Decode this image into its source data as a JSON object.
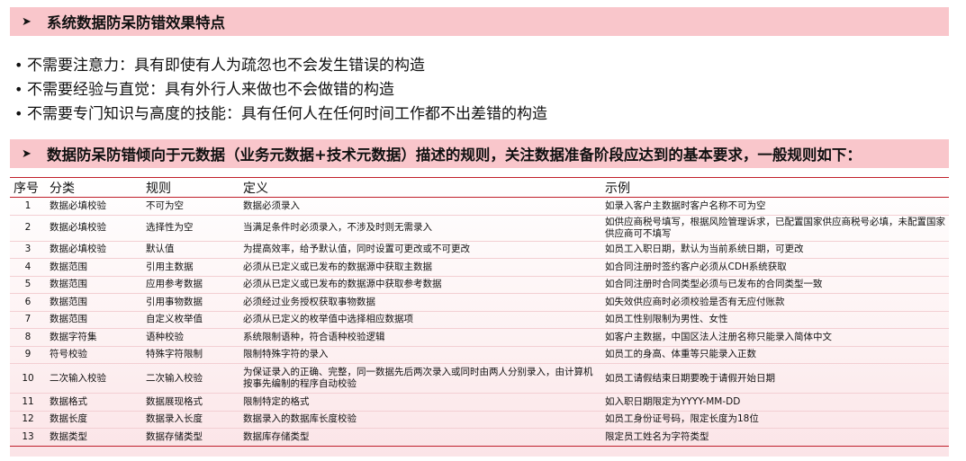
{
  "banner1": {
    "arrow": "➤",
    "text": "系统数据防呆防错效果特点"
  },
  "bullets": [
    {
      "dot": "•",
      "text": "不需要注意力：具有即使有人为疏忽也不会发生错误的构造"
    },
    {
      "dot": "•",
      "text": "不需要经验与直觉：具有外行人来做也不会做错的构造"
    },
    {
      "dot": "•",
      "text": "不需要专门知识与高度的技能：具有任何人在任何时间工作都不出差错的构造"
    }
  ],
  "banner2": {
    "arrow": "➤",
    "text": "数据防呆防错倾向于元数据（业务元数据+技术元数据）描述的规则，关注数据准备阶段应达到的基本要求，一般规则如下："
  },
  "table": {
    "headers": [
      "序号",
      "分类",
      "规则",
      "定义",
      "示例"
    ],
    "rows": [
      [
        "1",
        "数据必填校验",
        "不可为空",
        "数据必须录入",
        "如录入客户主数据时客户名称不可为空"
      ],
      [
        "2",
        "数据必填校验",
        "选择性为空",
        "当满足条件时必须录入，不涉及时则无需录入",
        "如供应商税号填写，根据风险管理诉求，已配置国家供应商税号必填，未配置国家供应商可不填写"
      ],
      [
        "3",
        "数据必填校验",
        "默认值",
        "为提高效率，给予默认值，同时设置可更改或不可更改",
        "如员工入职日期，默认为当前系统日期，可更改"
      ],
      [
        "4",
        "数据范围",
        "引用主数据",
        "必须从已定义或已发布的数据源中获取主数据",
        "如合同注册时签约客户必须从CDH系统获取"
      ],
      [
        "5",
        "数据范围",
        "应用参考数据",
        "必须从已定义或已发布的数据源中获取参考数据",
        "如合同注册时合同类型必须与已发布的合同类型一致"
      ],
      [
        "6",
        "数据范围",
        "引用事物数据",
        "必须经过业务授权获取事物数据",
        "如失效供应商时必须校验是否有无应付账款"
      ],
      [
        "7",
        "数据范围",
        "自定义枚举值",
        "必须从已定义的枚举值中选择相应数据项",
        "如员工性别限制为男性、女性"
      ],
      [
        "8",
        "数据字符集",
        "语种校验",
        "系统限制语种，符合语种校验逻辑",
        "如客户主数据，中国区法人注册名称只能录入简体中文"
      ],
      [
        "9",
        "符号校验",
        "特殊字符限制",
        "限制特殊字符的录入",
        "如员工的身高、体重等只能录入正数"
      ],
      [
        "10",
        "二次输入校验",
        "二次输入校验",
        "为保证录入的正确、完整，同一数据先后两次录入或同时由两人分别录入，由计算机按事先编制的程序自动校验",
        "如员工请假结束日期要晚于请假开始日期"
      ],
      [
        "11",
        "数据格式",
        "数据展现格式",
        "限制特定的格式",
        "如入职日期限定为YYYY-MM-DD"
      ],
      [
        "12",
        "数据长度",
        "数据录入长度",
        "数据录入的数据库长度校验",
        "如员工身份证号码，限定长度为18位"
      ],
      [
        "13",
        "数据类型",
        "数据存储类型",
        "数据库存储类型",
        "限定员工姓名为字符类型"
      ]
    ]
  }
}
